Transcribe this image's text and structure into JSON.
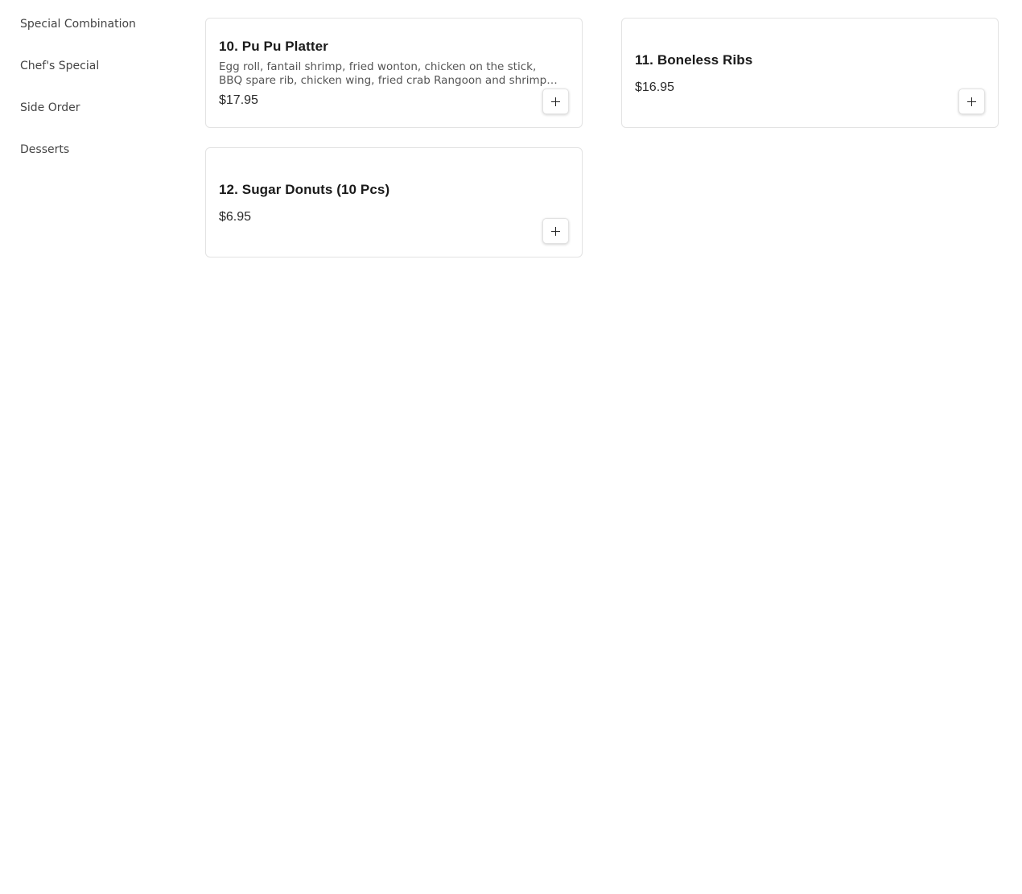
{
  "sidebar": {
    "items": [
      {
        "label": "Special Combination"
      },
      {
        "label": "Chef's Special"
      },
      {
        "label": "Side Order"
      },
      {
        "label": "Desserts"
      }
    ]
  },
  "menu": {
    "items": [
      {
        "title": "10. Pu Pu Platter",
        "description": "Egg roll, fantail shrimp, fried wonton, chicken on the stick, BBQ spare rib, chicken wing, fried crab Rangoon and shrimp toast",
        "price": "$17.95",
        "add_icon": "plus-icon"
      },
      {
        "title": "11. Boneless Ribs",
        "description": "",
        "price": "$16.95",
        "add_icon": "plus-icon"
      },
      {
        "title": "12. Sugar Donuts (10 Pcs)",
        "description": "",
        "price": "$6.95",
        "add_icon": "plus-icon"
      }
    ]
  }
}
